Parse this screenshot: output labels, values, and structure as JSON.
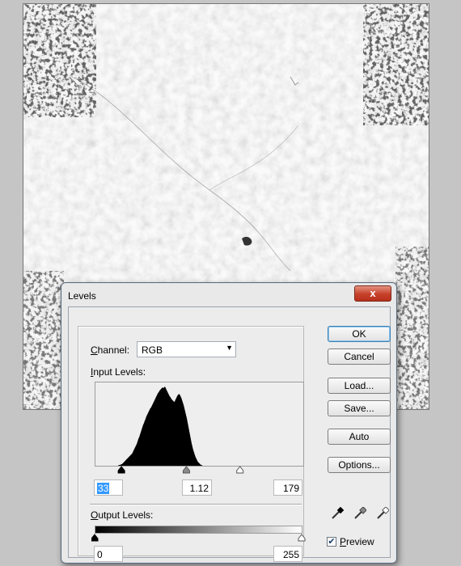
{
  "dialog": {
    "title": "Levels",
    "close_glyph": "x",
    "channel": {
      "label": "Channel:",
      "value": "RGB"
    },
    "input_levels": {
      "label": "Input Levels:",
      "black": "33",
      "gamma": "1.12",
      "white": "179",
      "black_level": 33,
      "gamma_level": 1.12,
      "white_level": 179
    },
    "output_levels": {
      "label": "Output Levels:",
      "black": "0",
      "white": "255",
      "black_level": 0,
      "white_level": 255
    },
    "buttons": {
      "ok": "OK",
      "cancel": "Cancel",
      "load": "Load...",
      "save": "Save...",
      "auto": "Auto",
      "options": "Options..."
    },
    "eyedroppers": [
      "black-eyedropper-icon",
      "gray-eyedropper-icon",
      "white-eyedropper-icon"
    ],
    "preview": {
      "label": "Preview",
      "checked": true
    }
  },
  "histogram_profile": [
    0,
    0,
    0,
    0,
    0,
    0,
    0,
    0,
    0,
    0,
    0,
    0,
    0,
    0,
    0,
    0,
    0,
    0,
    0,
    0,
    0,
    0,
    0,
    0,
    0,
    0,
    0,
    0,
    0,
    0,
    1,
    1,
    1,
    2,
    2,
    3,
    4,
    5,
    6,
    7,
    8,
    9,
    10,
    11,
    12,
    13,
    14,
    15,
    17,
    19,
    21,
    23,
    25,
    27,
    30,
    33,
    35,
    38,
    41,
    44,
    47,
    50,
    52,
    55,
    57,
    60,
    62,
    64,
    66,
    68,
    70,
    71,
    73,
    75,
    77,
    79,
    81,
    83,
    85,
    87,
    89,
    90,
    92,
    93,
    94,
    95,
    96,
    95,
    96,
    97,
    95,
    93,
    91,
    89,
    87,
    85,
    84,
    82,
    81,
    80,
    79,
    78,
    80,
    82,
    84,
    86,
    87,
    88,
    87,
    85,
    83,
    80,
    77,
    74,
    70,
    66,
    62,
    58,
    53,
    48,
    43,
    38,
    33,
    28,
    24,
    20,
    17,
    14,
    11,
    9,
    7,
    5,
    4,
    3,
    2,
    1,
    1,
    0,
    0,
    0,
    0,
    0,
    0,
    0,
    0,
    0,
    0,
    0,
    0,
    0,
    0,
    0,
    0,
    0,
    0,
    0,
    0,
    0,
    0,
    0,
    0,
    0,
    0,
    0,
    0,
    0,
    0,
    0,
    0,
    0,
    0,
    0,
    0,
    0,
    0,
    0,
    0,
    0,
    0,
    0,
    0,
    0,
    0,
    0,
    0,
    0,
    0,
    0,
    0,
    0,
    0,
    0,
    0,
    0,
    0,
    0,
    0,
    0,
    0,
    0,
    0,
    0,
    0,
    0,
    0,
    0,
    0,
    0,
    0,
    0,
    0,
    0,
    0,
    0,
    0,
    0,
    0,
    0,
    0,
    0,
    0,
    0,
    0,
    0,
    0,
    0,
    0,
    0,
    0,
    0,
    0,
    0,
    0,
    0,
    0,
    0,
    0,
    0,
    0,
    0,
    0,
    0,
    0,
    0,
    0,
    0,
    0,
    0,
    0,
    0,
    0,
    0,
    0,
    0,
    0,
    0,
    0,
    0,
    0,
    0,
    0,
    0,
    0,
    0,
    0,
    0
  ],
  "colors": {
    "close_button": "#c6402a",
    "selection": "#3399ff",
    "default_button_border": "#3c7fb1"
  }
}
